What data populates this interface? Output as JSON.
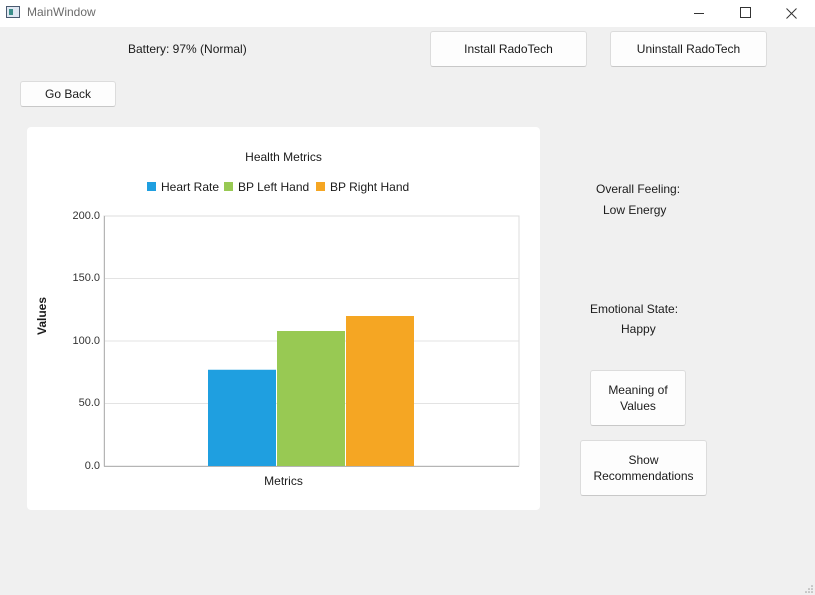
{
  "window": {
    "title": "MainWindow"
  },
  "header": {
    "battery_text": "Battery: 97% (Normal)",
    "install_label": "Install RadoTech",
    "uninstall_label": "Uninstall RadoTech",
    "back_label": "Go Back"
  },
  "side": {
    "overall_feeling_label": "Overall Feeling:",
    "overall_feeling_value": "Low Energy",
    "emotional_state_label": "Emotional State:",
    "emotional_state_value": "Happy",
    "meaning_label_1": "Meaning of",
    "meaning_label_2": "Values",
    "recommend_label_1": "Show",
    "recommend_label_2": "Recommendations"
  },
  "chart_data": {
    "type": "bar",
    "title": "Health Metrics",
    "xlabel": "Metrics",
    "ylabel": "Values",
    "categories": [
      "Metrics"
    ],
    "ylim": [
      0,
      200
    ],
    "yticks": [
      "0.0",
      "50.0",
      "100.0",
      "150.0",
      "200.0"
    ],
    "grid": true,
    "legend_position": "top",
    "series": [
      {
        "name": "Heart Rate",
        "values": [
          77
        ],
        "color": "#1f9fe0"
      },
      {
        "name": "BP Left Hand",
        "values": [
          108
        ],
        "color": "#98c953"
      },
      {
        "name": "BP Right Hand",
        "values": [
          120
        ],
        "color": "#f5a623"
      }
    ]
  }
}
